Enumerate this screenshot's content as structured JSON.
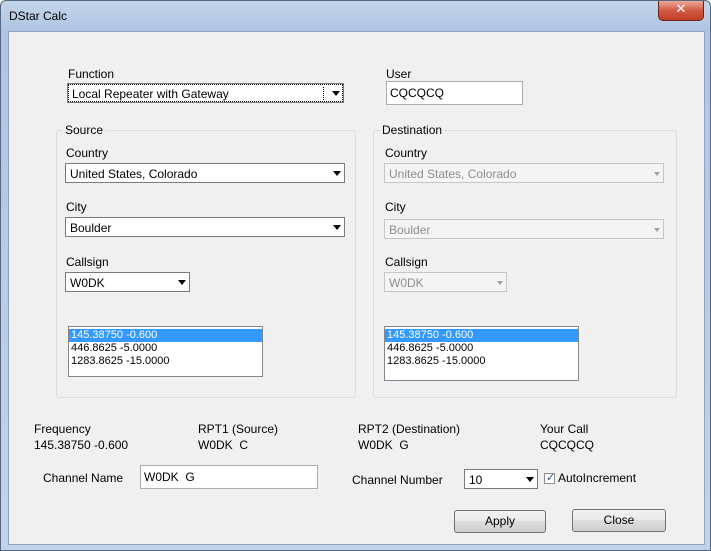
{
  "window": {
    "title": "DStar Calc"
  },
  "function": {
    "label": "Function",
    "value": "Local Repeater with Gateway"
  },
  "user": {
    "label": "User",
    "value": "CQCQCQ"
  },
  "source": {
    "title": "Source",
    "country_label": "Country",
    "country_value": "United States, Colorado",
    "city_label": "City",
    "city_value": "Boulder",
    "callsign_label": "Callsign",
    "callsign_value": "W0DK",
    "frequencies": [
      "145.38750 -0.600",
      "446.8625 -5.0000",
      "1283.8625 -15.0000"
    ]
  },
  "destination": {
    "title": "Destination",
    "country_label": "Country",
    "country_value": "United States, Colorado",
    "city_label": "City",
    "city_value": "Boulder",
    "callsign_label": "Callsign",
    "callsign_value": "W0DK",
    "frequencies": [
      "145.38750 -0.600",
      "446.8625 -5.0000",
      "1283.8625 -15.0000"
    ]
  },
  "summary": {
    "frequency_label": "Frequency",
    "frequency_value": "145.38750 -0.600",
    "rpt1_label": "RPT1 (Source)",
    "rpt1_value": "W0DK  C",
    "rpt2_label": "RPT2 (Destination)",
    "rpt2_value": "W0DK  G",
    "yourcall_label": "Your Call",
    "yourcall_value": "CQCQCQ"
  },
  "channel": {
    "name_label": "Channel Name",
    "name_value": "W0DK  G",
    "number_label": "Channel Number",
    "number_value": "10",
    "autoincrement_label": "AutoIncrement",
    "autoincrement_checked": true
  },
  "buttons": {
    "apply": "Apply",
    "close": "Close"
  },
  "colors": {
    "selection": "#3399ff",
    "close_button": "#c23d27",
    "frame": "#aec5e2"
  }
}
